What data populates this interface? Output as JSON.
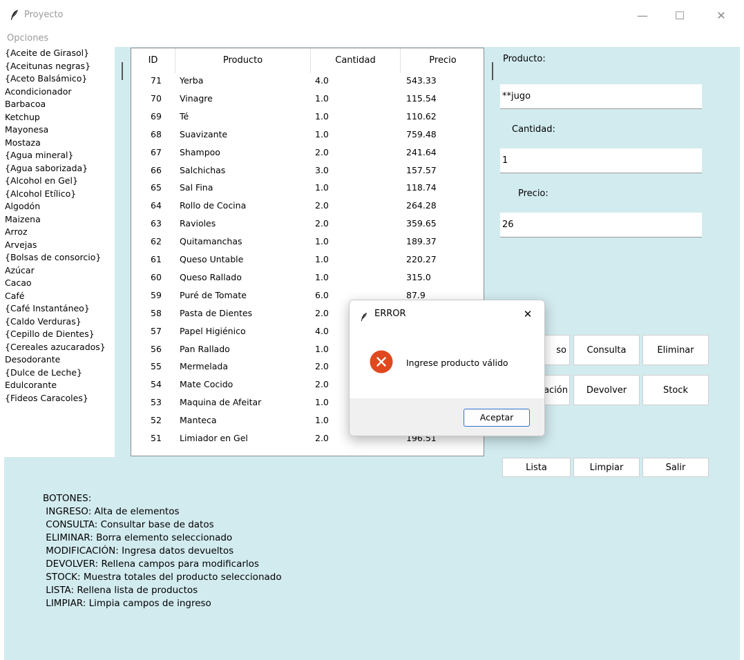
{
  "window": {
    "title": "Proyecto",
    "minimize": "—",
    "maximize": "☐",
    "close": "✕"
  },
  "menu": {
    "opciones": "Opciones"
  },
  "product_list": [
    "{Aceite de Girasol}",
    "{Aceitunas negras}",
    "{Aceto Balsámico}",
    "Acondicionador",
    "Barbacoa",
    "Ketchup",
    "Mayonesa",
    "Mostaza",
    "{Agua mineral}",
    "{Agua saborizada}",
    "{Alcohol en Gel}",
    "{Alcohol Etílico}",
    "Algodón",
    "Maizena",
    "Arroz",
    "Arvejas",
    "{Bolsas de consorcio}",
    "Azúcar",
    "Cacao",
    "Café",
    "{Café Instantáneo}",
    "{Caldo Verduras}",
    "{Cepillo de Dientes}",
    "{Cereales azucarados}",
    "Desodorante",
    "{Dulce de Leche}",
    "Edulcorante",
    "{Fideos Caracoles}"
  ],
  "table": {
    "headers": [
      "ID",
      "Producto",
      "Cantidad",
      "Precio"
    ],
    "rows": [
      [
        "71",
        "Yerba",
        "4.0",
        "543.33"
      ],
      [
        "70",
        "Vinagre",
        "1.0",
        "115.54"
      ],
      [
        "69",
        "Té",
        "1.0",
        "110.62"
      ],
      [
        "68",
        "Suavizante",
        "1.0",
        "759.48"
      ],
      [
        "67",
        "Shampoo",
        "2.0",
        "241.64"
      ],
      [
        "66",
        "Salchichas",
        "3.0",
        "157.57"
      ],
      [
        "65",
        "Sal Fina",
        "1.0",
        "118.74"
      ],
      [
        "64",
        "Rollo de Cocina",
        "2.0",
        "264.28"
      ],
      [
        "63",
        "Ravioles",
        "2.0",
        "359.65"
      ],
      [
        "62",
        "Quitamanchas",
        "1.0",
        "189.37"
      ],
      [
        "61",
        "Queso Untable",
        "1.0",
        "220.27"
      ],
      [
        "60",
        "Queso Rallado",
        "1.0",
        "315.0"
      ],
      [
        "59",
        "Puré de Tomate",
        "6.0",
        "87.9"
      ],
      [
        "58",
        "Pasta de Dientes",
        "2.0",
        ""
      ],
      [
        "57",
        "Papel Higiénico",
        "4.0",
        ""
      ],
      [
        "56",
        "Pan Rallado",
        "1.0",
        ""
      ],
      [
        "55",
        "Mermelada",
        "2.0",
        ""
      ],
      [
        "54",
        "Mate Cocido",
        "2.0",
        ""
      ],
      [
        "53",
        "Maquina de Afeitar",
        "1.0",
        ""
      ],
      [
        "52",
        "Manteca",
        "1.0",
        ""
      ],
      [
        "51",
        "Limiador en Gel",
        "2.0",
        "196.51"
      ]
    ]
  },
  "form": {
    "producto_label": "Producto:",
    "producto_value": "**jugo",
    "cantidad_label": "Cantidad:",
    "cantidad_value": "1",
    "precio_label": "Precio:",
    "precio_value": "26"
  },
  "buttons": {
    "ingreso_visible": "so",
    "consulta": "Consulta",
    "eliminar": "Eliminar",
    "modificacion_visible": "ación",
    "devolver": "Devolver",
    "stock": "Stock",
    "lista": "Lista",
    "limpiar": "Limpiar",
    "salir": "Salir"
  },
  "help_text": "BOTONES:\n INGRESO: Alta de elementos\n CONSULTA: Consultar base de datos\n ELIMINAR: Borra elemento seleccionado\n MODIFICACIÓN: Ingresa datos devueltos\n DEVOLVER: Rellena campos para modificarlos\n STOCK: Muestra totales del producto seleccionado\n LISTA: Rellena lista de productos\n LIMPIAR: Limpia campos de ingreso",
  "dialog": {
    "title": "ERROR",
    "message": "Ingrese producto válido",
    "accept": "Aceptar",
    "close": "✕"
  },
  "colors": {
    "work_bg": "#d2ebef",
    "error_icon": "#e0481e"
  }
}
